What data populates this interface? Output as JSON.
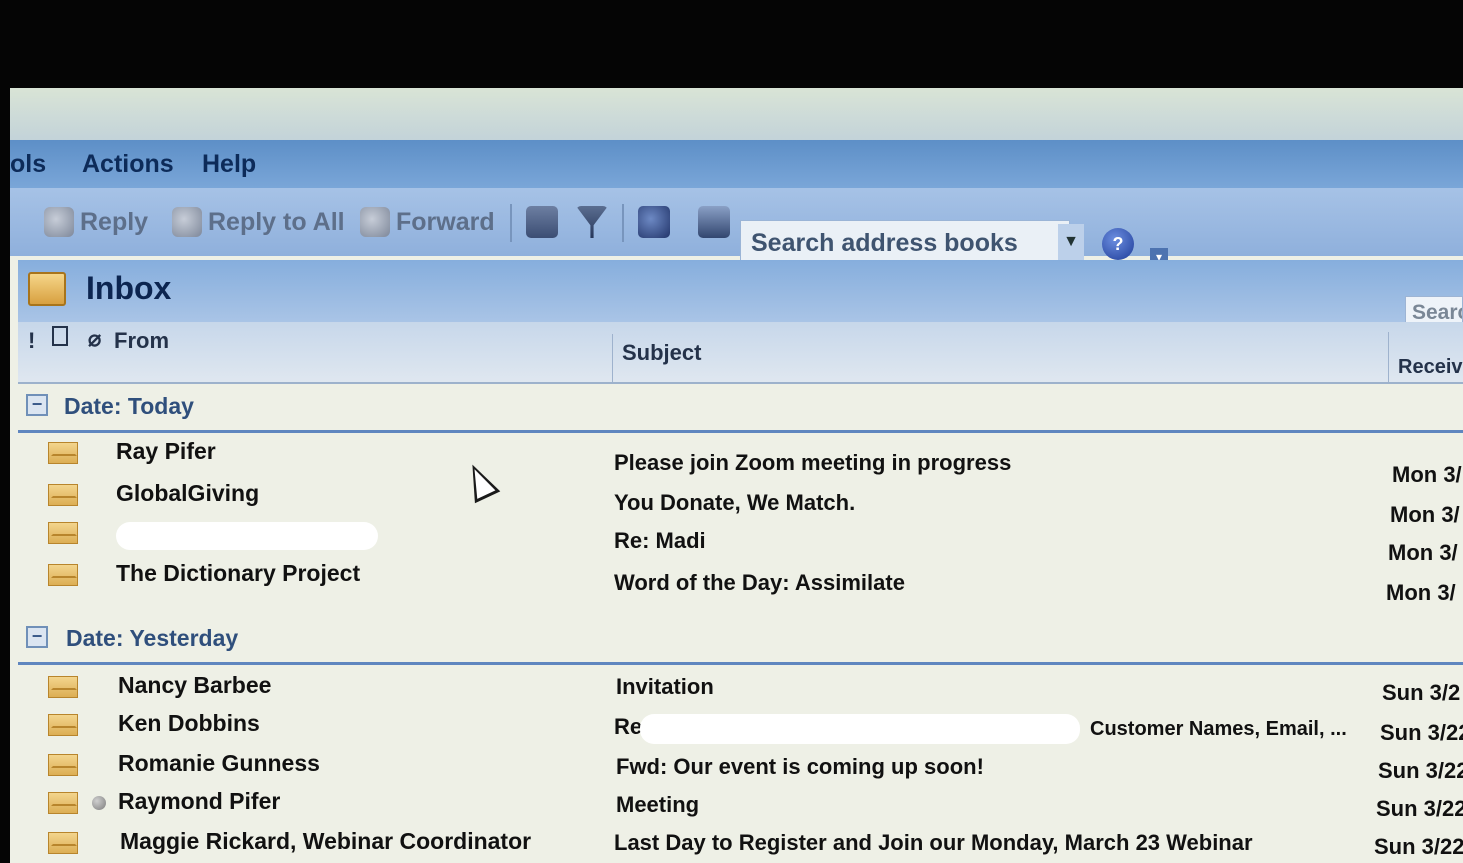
{
  "menu": {
    "items": [
      "ols",
      "Actions",
      "Help"
    ]
  },
  "toolbar": {
    "reply": "Reply",
    "reply_all": "Reply to All",
    "forward": "Forward",
    "search_address_books": "Search address books"
  },
  "inbox": {
    "title": "Inbox",
    "search_placeholder": "Searc",
    "columns": {
      "from": "From",
      "subject": "Subject",
      "received": "Receiv"
    }
  },
  "groups": [
    {
      "label": "Date: Today",
      "messages": [
        {
          "from": "Ray Pifer",
          "subject": "Please join Zoom meeting in progress",
          "received": "Mon 3/"
        },
        {
          "from": "GlobalGiving",
          "subject": "You Donate, We Match.",
          "received": "Mon 3/"
        },
        {
          "from": "",
          "subject": "Re: Madi",
          "received": "Mon 3/"
        },
        {
          "from": "The Dictionary Project",
          "subject": "Word of the Day: Assimilate",
          "received": "Mon 3/"
        }
      ]
    },
    {
      "label": "Date: Yesterday",
      "messages": [
        {
          "from": "Nancy Barbee",
          "subject": "Invitation",
          "received": "Sun 3/2"
        },
        {
          "from": "Ken Dobbins",
          "subject": "Re",
          "subject_tail": "Customer Names, Email, ...",
          "received": "Sun 3/22"
        },
        {
          "from": "Romanie Gunness",
          "subject": "Fwd: Our event is coming up soon!",
          "received": "Sun 3/22"
        },
        {
          "from": "Raymond Pifer",
          "subject": "Meeting",
          "received": "Sun 3/22"
        },
        {
          "from": "Maggie Rickard, Webinar Coordinator",
          "subject": "Last Day to Register and Join our Monday, March 23 Webinar",
          "received": "Sun 3/22"
        }
      ]
    }
  ]
}
